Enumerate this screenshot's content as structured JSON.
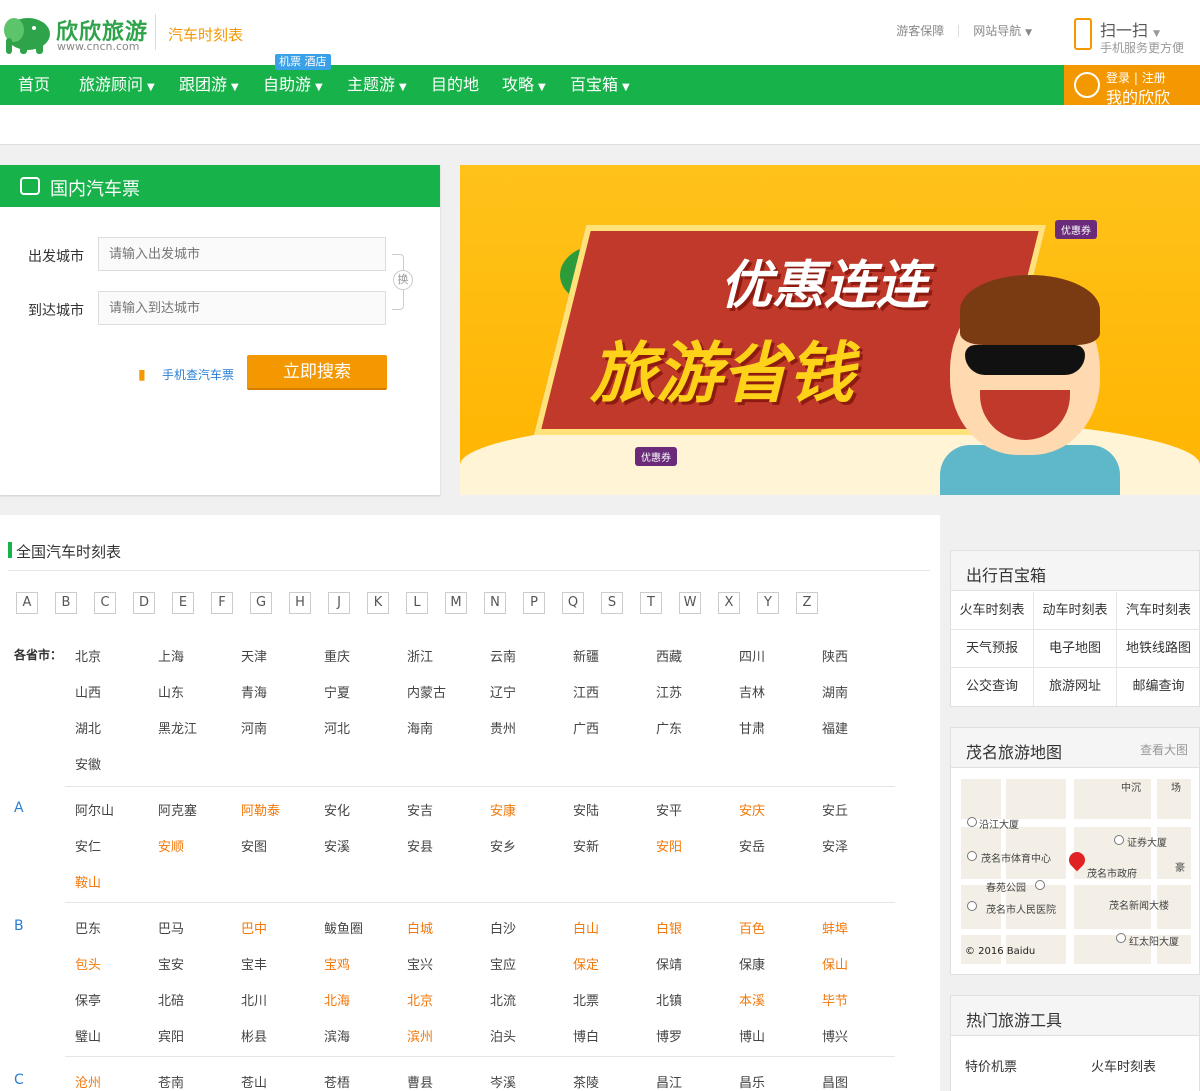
{
  "header": {
    "logo_text": "欣欣旅游",
    "logo_url": "www.cncn.com",
    "site_sub": "汽车时刻表",
    "top_links": [
      "游客保障",
      "网站导航"
    ],
    "scan_label": "扫一扫",
    "scan_sub": "手机服务更方便"
  },
  "nav": {
    "items": [
      {
        "label": "首页",
        "caret": false
      },
      {
        "label": "旅游顾问",
        "caret": true
      },
      {
        "label": "跟团游",
        "caret": true
      },
      {
        "label": "自助游",
        "caret": true
      },
      {
        "label": "主题游",
        "caret": true
      },
      {
        "label": "目的地",
        "caret": false
      },
      {
        "label": "攻略",
        "caret": true
      },
      {
        "label": "百宝箱",
        "caret": true
      }
    ],
    "badge": "机票 酒店",
    "login": "登录",
    "register": "注册",
    "my": "我的欣欣"
  },
  "search": {
    "title": "国内汽车票",
    "from_label": "出发城市",
    "from_placeholder": "请输入出发城市",
    "to_label": "到达城市",
    "to_placeholder": "请输入到达城市",
    "swap": "换",
    "mobile_link": "手机查汽车票",
    "search_btn": "立即搜索"
  },
  "banner": {
    "line1": "优惠连连",
    "line2": "旅游省钱",
    "coupon": "优惠券"
  },
  "list": {
    "title": "全国汽车时刻表",
    "letters": [
      "A",
      "B",
      "C",
      "D",
      "E",
      "F",
      "G",
      "H",
      "J",
      "K",
      "L",
      "M",
      "N",
      "P",
      "Q",
      "S",
      "T",
      "W",
      "X",
      "Y",
      "Z"
    ],
    "province_label": "各省市：",
    "provinces": [
      "北京",
      "上海",
      "天津",
      "重庆",
      "浙江",
      "云南",
      "新疆",
      "西藏",
      "四川",
      "陕西",
      "山西",
      "山东",
      "青海",
      "宁夏",
      "内蒙古",
      "辽宁",
      "江西",
      "江苏",
      "吉林",
      "湖南",
      "湖北",
      "黑龙江",
      "河南",
      "河北",
      "海南",
      "贵州",
      "广西",
      "广东",
      "甘肃",
      "福建",
      "安徽"
    ],
    "groups": [
      {
        "letter": "A",
        "cities": [
          {
            "name": "阿尔山",
            "hot": false
          },
          {
            "name": "阿克塞",
            "hot": false
          },
          {
            "name": "阿勒泰",
            "hot": true
          },
          {
            "name": "安化",
            "hot": false
          },
          {
            "name": "安吉",
            "hot": false
          },
          {
            "name": "安康",
            "hot": true
          },
          {
            "name": "安陆",
            "hot": false
          },
          {
            "name": "安平",
            "hot": false
          },
          {
            "name": "安庆",
            "hot": true
          },
          {
            "name": "安丘",
            "hot": false
          },
          {
            "name": "安仁",
            "hot": false
          },
          {
            "name": "安顺",
            "hot": true
          },
          {
            "name": "安图",
            "hot": false
          },
          {
            "name": "安溪",
            "hot": false
          },
          {
            "name": "安县",
            "hot": false
          },
          {
            "name": "安乡",
            "hot": false
          },
          {
            "name": "安新",
            "hot": false
          },
          {
            "name": "安阳",
            "hot": true
          },
          {
            "name": "安岳",
            "hot": false
          },
          {
            "name": "安泽",
            "hot": false
          },
          {
            "name": "鞍山",
            "hot": true
          }
        ]
      },
      {
        "letter": "B",
        "cities": [
          {
            "name": "巴东",
            "hot": false
          },
          {
            "name": "巴马",
            "hot": false
          },
          {
            "name": "巴中",
            "hot": true
          },
          {
            "name": "鲅鱼圈",
            "hot": false
          },
          {
            "name": "白城",
            "hot": true
          },
          {
            "name": "白沙",
            "hot": false
          },
          {
            "name": "白山",
            "hot": true
          },
          {
            "name": "白银",
            "hot": true
          },
          {
            "name": "百色",
            "hot": true
          },
          {
            "name": "蚌埠",
            "hot": true
          },
          {
            "name": "包头",
            "hot": true
          },
          {
            "name": "宝安",
            "hot": false
          },
          {
            "name": "宝丰",
            "hot": false
          },
          {
            "name": "宝鸡",
            "hot": true
          },
          {
            "name": "宝兴",
            "hot": false
          },
          {
            "name": "宝应",
            "hot": false
          },
          {
            "name": "保定",
            "hot": true
          },
          {
            "name": "保靖",
            "hot": false
          },
          {
            "name": "保康",
            "hot": false
          },
          {
            "name": "保山",
            "hot": true
          },
          {
            "name": "保亭",
            "hot": false
          },
          {
            "name": "北碚",
            "hot": false
          },
          {
            "name": "北川",
            "hot": false
          },
          {
            "name": "北海",
            "hot": true
          },
          {
            "name": "北京",
            "hot": true
          },
          {
            "name": "北流",
            "hot": false
          },
          {
            "name": "北票",
            "hot": false
          },
          {
            "name": "北镇",
            "hot": false
          },
          {
            "name": "本溪",
            "hot": true
          },
          {
            "name": "毕节",
            "hot": true
          },
          {
            "name": "璧山",
            "hot": false
          },
          {
            "name": "宾阳",
            "hot": false
          },
          {
            "name": "彬县",
            "hot": false
          },
          {
            "name": "滨海",
            "hot": false
          },
          {
            "name": "滨州",
            "hot": true
          },
          {
            "name": "泊头",
            "hot": false
          },
          {
            "name": "博白",
            "hot": false
          },
          {
            "name": "博罗",
            "hot": false
          },
          {
            "name": "博山",
            "hot": false
          },
          {
            "name": "博兴",
            "hot": false
          }
        ]
      },
      {
        "letter": "C",
        "cities": [
          {
            "name": "沧州",
            "hot": true
          },
          {
            "name": "苍南",
            "hot": false
          },
          {
            "name": "苍山",
            "hot": false
          },
          {
            "name": "苍梧",
            "hot": false
          },
          {
            "name": "曹县",
            "hot": false
          },
          {
            "name": "岑溪",
            "hot": false
          },
          {
            "name": "茶陵",
            "hot": false
          },
          {
            "name": "昌江",
            "hot": false
          },
          {
            "name": "昌乐",
            "hot": false
          },
          {
            "name": "昌图",
            "hot": false
          }
        ]
      }
    ]
  },
  "sidebar": {
    "tools_title": "出行百宝箱",
    "tools": [
      "火车时刻表",
      "动车时刻表",
      "汽车时刻表",
      "天气预报",
      "电子地图",
      "地铁线路图",
      "公交查询",
      "旅游网址",
      "邮编查询"
    ],
    "map_title": "茂名旅游地图",
    "map_more": "查看大图",
    "map_pois": [
      "中沉",
      "场",
      "沿江大厦",
      "证券大厦",
      "茂名市体育中心",
      "茂名市政府",
      "豪",
      "春苑公园",
      "茂名市人民医院",
      "茂名新闻大楼",
      "红太阳大厦"
    ],
    "map_copy": "© 2016 Baidu",
    "hot_title": "热门旅游工具",
    "hot_tools": [
      "特价机票",
      "火车时刻表"
    ]
  },
  "colors": {
    "green": "#17b24a",
    "orange": "#f39800",
    "link_blue": "#2a7fd4",
    "hot_orange": "#f3780a"
  }
}
